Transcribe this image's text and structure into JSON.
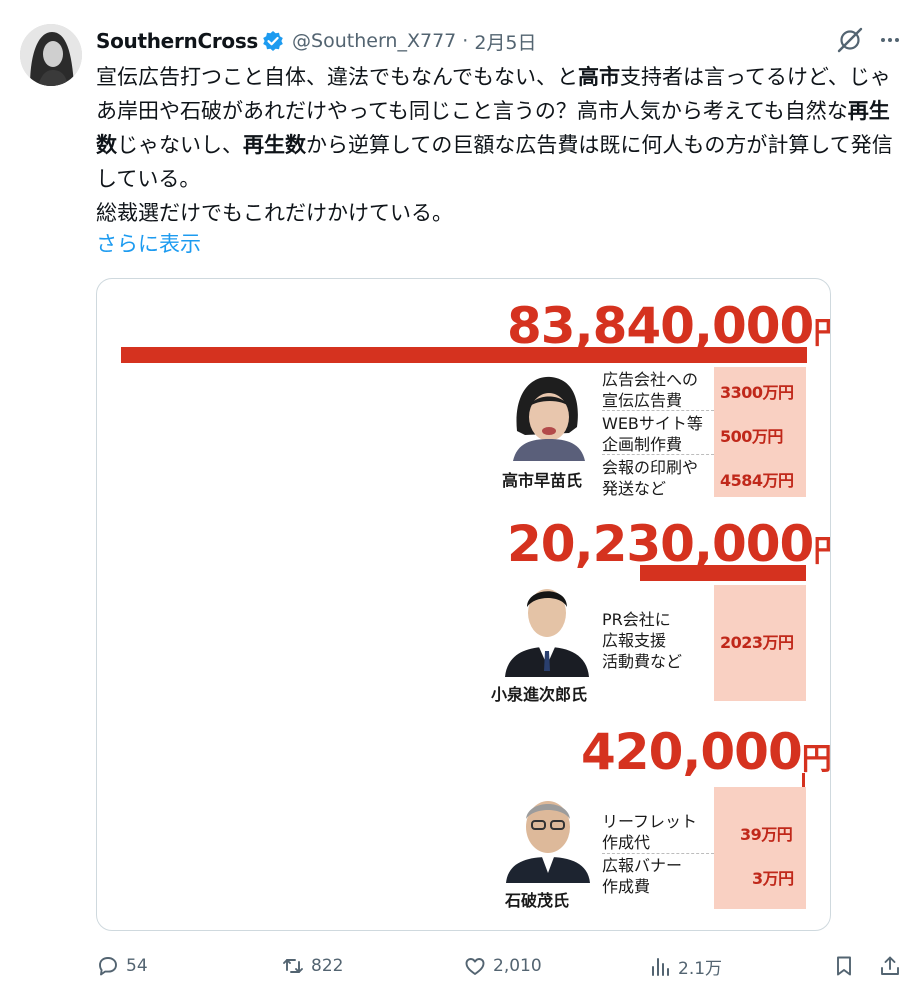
{
  "author": {
    "display_name": "SouthernCross",
    "handle": "@Southern_X777",
    "separator": "·",
    "date": "2月5日"
  },
  "tweet": {
    "segments": [
      {
        "text": "宣伝広告打つこと自体、違法でもなんでもない、と",
        "bold": false
      },
      {
        "text": "高市",
        "bold": true
      },
      {
        "text": "支持者は言ってるけど、じゃあ岸田や石破があれだけやっても同じこと言うの？高市人気から考えても自然な",
        "bold": false
      },
      {
        "text": "再生数",
        "bold": true
      },
      {
        "text": "じゃないし、",
        "bold": false
      },
      {
        "text": "再生数",
        "bold": true
      },
      {
        "text": "から逆算しての巨額な広告費は既に何人もの方が計算して発信している。",
        "bold": false
      },
      {
        "text": "\n総裁選だけでもこれだけかけている。",
        "bold": false
      }
    ],
    "show_more": "さらに表示"
  },
  "infographic": {
    "blocks": [
      {
        "total": "83,840,000",
        "currency": "円",
        "person": "高市早苗氏",
        "items": [
          {
            "label": "広告会社への\n宣伝広告費",
            "amount": "3300万円"
          },
          {
            "label": "WEBサイト等\n企画制作費",
            "amount": "500万円"
          },
          {
            "label": "会報の印刷や\n発送など",
            "amount": "4584万円"
          }
        ]
      },
      {
        "total": "20,230,000",
        "currency": "円",
        "person": "小泉進次郎氏",
        "items": [
          {
            "label": "PR会社に\n広報支援\n活動費など",
            "amount": "2023万円"
          }
        ]
      },
      {
        "total": "420,000",
        "currency": "円",
        "person": "石破茂氏",
        "items": [
          {
            "label": "リーフレット\n作成代",
            "amount": "39万円"
          },
          {
            "label": "広報バナー\n作成費",
            "amount": "3万円"
          }
        ]
      }
    ]
  },
  "actions": {
    "reply_count": "54",
    "retweet_count": "822",
    "like_count": "2,010",
    "view_count": "2.1万"
  },
  "colors": {
    "accent_red": "#d5321f",
    "pink_cell": "#f9d0c2",
    "link_blue": "#1d9bf0",
    "muted": "#536471",
    "verified": "#1d9bf0"
  }
}
